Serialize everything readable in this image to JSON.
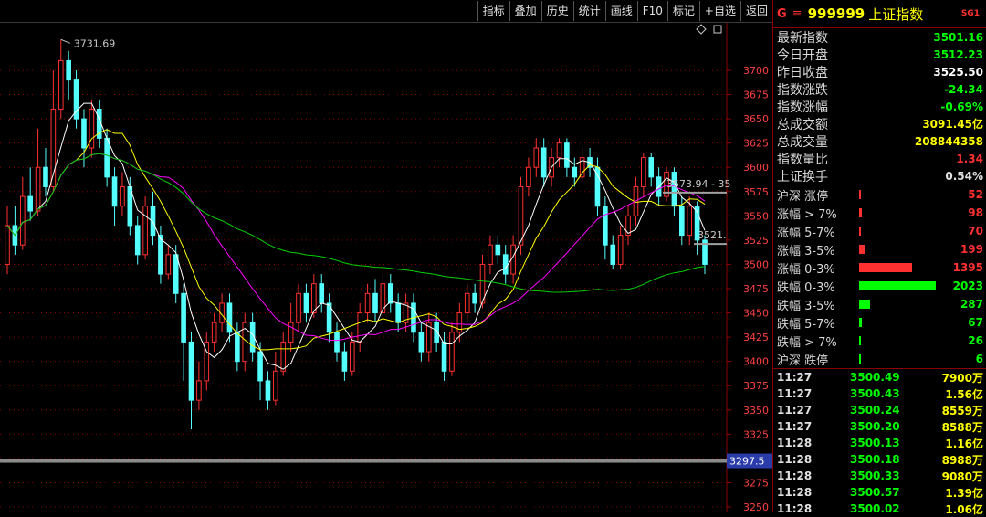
{
  "toolbar": {
    "buttons": [
      "指标",
      "叠加",
      "历史",
      "统计",
      "画线",
      "F10",
      "标记",
      "+自选",
      "返回"
    ]
  },
  "header": {
    "g": "G",
    "menu": "≡",
    "code": "999999",
    "name": "上证指数",
    "tag": "SG1"
  },
  "stats": [
    {
      "label": "最新指数",
      "value": "3501.16",
      "color": "#00ff00"
    },
    {
      "label": "今日开盘",
      "value": "3512.23",
      "color": "#00ff00"
    },
    {
      "label": "昨日收盘",
      "value": "3525.50",
      "color": "#ffffff"
    },
    {
      "label": "指数涨跌",
      "value": "-24.34",
      "color": "#00ff00"
    },
    {
      "label": "指数涨幅",
      "value": "-0.69%",
      "color": "#00ff00"
    },
    {
      "label": "总成交额",
      "value": "3091.45亿",
      "color": "#ffff00"
    },
    {
      "label": "总成交量",
      "value": "208844358",
      "color": "#ffff00"
    },
    {
      "label": "指数量比",
      "value": "1.34",
      "color": "#ff3030"
    },
    {
      "label": "上证换手",
      "value": "0.54%",
      "color": "#e0e0e0"
    }
  ],
  "distribution": [
    {
      "label": "沪深 涨停",
      "value": "52",
      "color": "#ff3030",
      "fraction": 0.02
    },
    {
      "label": "涨幅 > 7%",
      "value": "98",
      "color": "#ff3030",
      "fraction": 0.03
    },
    {
      "label": "涨幅 5-7%",
      "value": "70",
      "color": "#ff3030",
      "fraction": 0.025
    },
    {
      "label": "涨幅 3-5%",
      "value": "199",
      "color": "#ff3030",
      "fraction": 0.08
    },
    {
      "label": "涨幅 0-3%",
      "value": "1395",
      "color": "#ff3030",
      "fraction": 0.69
    },
    {
      "label": "跌幅 0-3%",
      "value": "2023",
      "color": "#00ff00",
      "fraction": 1.0
    },
    {
      "label": "跌幅 3-5%",
      "value": "287",
      "color": "#00ff00",
      "fraction": 0.14
    },
    {
      "label": "跌幅 5-7%",
      "value": "67",
      "color": "#00ff00",
      "fraction": 0.03
    },
    {
      "label": "跌幅 > 7%",
      "value": "26",
      "color": "#00ff00",
      "fraction": 0.012
    },
    {
      "label": "沪深 跌停",
      "value": "6",
      "color": "#00ff00",
      "fraction": 0.005
    }
  ],
  "ticks": [
    {
      "time": "11:27",
      "price": "3500.49",
      "vol": "7900万"
    },
    {
      "time": "11:27",
      "price": "3500.43",
      "vol": "1.56亿"
    },
    {
      "time": "11:27",
      "price": "3500.24",
      "vol": "8559万"
    },
    {
      "time": "11:27",
      "price": "3500.20",
      "vol": "8588万"
    },
    {
      "time": "11:28",
      "price": "3500.13",
      "vol": "1.16亿"
    },
    {
      "time": "11:28",
      "price": "3500.18",
      "vol": "8988万"
    },
    {
      "time": "11:28",
      "price": "3500.33",
      "vol": "9080万"
    },
    {
      "time": "11:28",
      "price": "3500.57",
      "vol": "1.39亿"
    },
    {
      "time": "11:28",
      "price": "3500.02",
      "vol": "1.06亿"
    }
  ],
  "chart_data": {
    "type": "candlestick",
    "ylim": [
      3250,
      3725
    ],
    "y_ticks": [
      3250,
      3275,
      3300,
      3325,
      3350,
      3375,
      3400,
      3425,
      3450,
      3475,
      3500,
      3525,
      3550,
      3575,
      3600,
      3625,
      3650,
      3675,
      3700
    ],
    "annotations": {
      "high_label": "3731.69",
      "mark1": "3573.94 - 35",
      "mark2": "3521.",
      "current_label": "3297.5"
    },
    "candles": [
      [
        3500,
        3540,
        3490,
        3560
      ],
      [
        3540,
        3520,
        3510,
        3560
      ],
      [
        3520,
        3570,
        3515,
        3590
      ],
      [
        3570,
        3555,
        3545,
        3600
      ],
      [
        3555,
        3600,
        3550,
        3640
      ],
      [
        3600,
        3580,
        3570,
        3620
      ],
      [
        3580,
        3660,
        3575,
        3700
      ],
      [
        3660,
        3710,
        3650,
        3731.69
      ],
      [
        3710,
        3690,
        3670,
        3720
      ],
      [
        3690,
        3650,
        3640,
        3700
      ],
      [
        3650,
        3620,
        3600,
        3660
      ],
      [
        3620,
        3660,
        3610,
        3670
      ],
      [
        3660,
        3630,
        3620,
        3670
      ],
      [
        3630,
        3590,
        3580,
        3640
      ],
      [
        3590,
        3560,
        3540,
        3600
      ],
      [
        3560,
        3580,
        3550,
        3595
      ],
      [
        3580,
        3540,
        3530,
        3590
      ],
      [
        3540,
        3510,
        3500,
        3550
      ],
      [
        3510,
        3560,
        3505,
        3570
      ],
      [
        3560,
        3530,
        3520,
        3575
      ],
      [
        3530,
        3490,
        3480,
        3540
      ],
      [
        3490,
        3510,
        3485,
        3520
      ],
      [
        3510,
        3470,
        3460,
        3520
      ],
      [
        3470,
        3420,
        3380,
        3480
      ],
      [
        3420,
        3360,
        3330,
        3430
      ],
      [
        3360,
        3380,
        3350,
        3400
      ],
      [
        3380,
        3420,
        3370,
        3430
      ],
      [
        3420,
        3440,
        3410,
        3450
      ],
      [
        3440,
        3460,
        3430,
        3470
      ],
      [
        3460,
        3430,
        3420,
        3470
      ],
      [
        3430,
        3400,
        3390,
        3440
      ],
      [
        3400,
        3440,
        3390,
        3450
      ],
      [
        3440,
        3410,
        3400,
        3450
      ],
      [
        3410,
        3380,
        3360,
        3420
      ],
      [
        3380,
        3360,
        3350,
        3390
      ],
      [
        3360,
        3390,
        3355,
        3410
      ],
      [
        3390,
        3420,
        3385,
        3430
      ],
      [
        3420,
        3440,
        3410,
        3460
      ],
      [
        3440,
        3470,
        3430,
        3480
      ],
      [
        3470,
        3450,
        3440,
        3480
      ],
      [
        3450,
        3480,
        3445,
        3490
      ],
      [
        3480,
        3460,
        3450,
        3490
      ],
      [
        3460,
        3430,
        3420,
        3470
      ],
      [
        3430,
        3410,
        3400,
        3440
      ],
      [
        3410,
        3390,
        3380,
        3420
      ],
      [
        3390,
        3420,
        3385,
        3430
      ],
      [
        3420,
        3450,
        3410,
        3460
      ],
      [
        3450,
        3470,
        3440,
        3480
      ],
      [
        3470,
        3450,
        3440,
        3485
      ],
      [
        3450,
        3480,
        3445,
        3490
      ],
      [
        3480,
        3460,
        3450,
        3490
      ],
      [
        3460,
        3440,
        3430,
        3470
      ],
      [
        3440,
        3460,
        3430,
        3470
      ],
      [
        3460,
        3430,
        3420,
        3470
      ],
      [
        3430,
        3410,
        3400,
        3440
      ],
      [
        3410,
        3440,
        3400,
        3450
      ],
      [
        3440,
        3420,
        3410,
        3450
      ],
      [
        3420,
        3390,
        3380,
        3430
      ],
      [
        3390,
        3430,
        3385,
        3440
      ],
      [
        3430,
        3450,
        3420,
        3460
      ],
      [
        3450,
        3470,
        3440,
        3480
      ],
      [
        3470,
        3460,
        3450,
        3480
      ],
      [
        3460,
        3500,
        3455,
        3510
      ],
      [
        3500,
        3520,
        3490,
        3530
      ],
      [
        3520,
        3510,
        3500,
        3530
      ],
      [
        3510,
        3490,
        3480,
        3520
      ],
      [
        3490,
        3520,
        3480,
        3530
      ],
      [
        3520,
        3580,
        3510,
        3590
      ],
      [
        3580,
        3600,
        3570,
        3610
      ],
      [
        3600,
        3620,
        3590,
        3630
      ],
      [
        3620,
        3590,
        3580,
        3630
      ],
      [
        3590,
        3610,
        3580,
        3620
      ],
      [
        3610,
        3625,
        3600,
        3630
      ],
      [
        3625,
        3600,
        3590,
        3630
      ],
      [
        3600,
        3590,
        3580,
        3610
      ],
      [
        3590,
        3610,
        3585,
        3620
      ],
      [
        3610,
        3600,
        3590,
        3620
      ],
      [
        3600,
        3560,
        3550,
        3610
      ],
      [
        3560,
        3520,
        3505,
        3570
      ],
      [
        3520,
        3500,
        3495,
        3530
      ],
      [
        3500,
        3530,
        3495,
        3540
      ],
      [
        3530,
        3550,
        3520,
        3560
      ],
      [
        3550,
        3580,
        3540,
        3590
      ],
      [
        3580,
        3610,
        3570,
        3615
      ],
      [
        3610,
        3590,
        3580,
        3615
      ],
      [
        3590,
        3570,
        3560,
        3600
      ],
      [
        3570,
        3595,
        3565,
        3600
      ],
      [
        3595,
        3560,
        3550,
        3600
      ],
      [
        3560,
        3530,
        3520,
        3570
      ],
      [
        3530,
        3560,
        3520,
        3570
      ],
      [
        3560,
        3525,
        3510,
        3565
      ],
      [
        3525,
        3500,
        3490,
        3530
      ]
    ]
  }
}
